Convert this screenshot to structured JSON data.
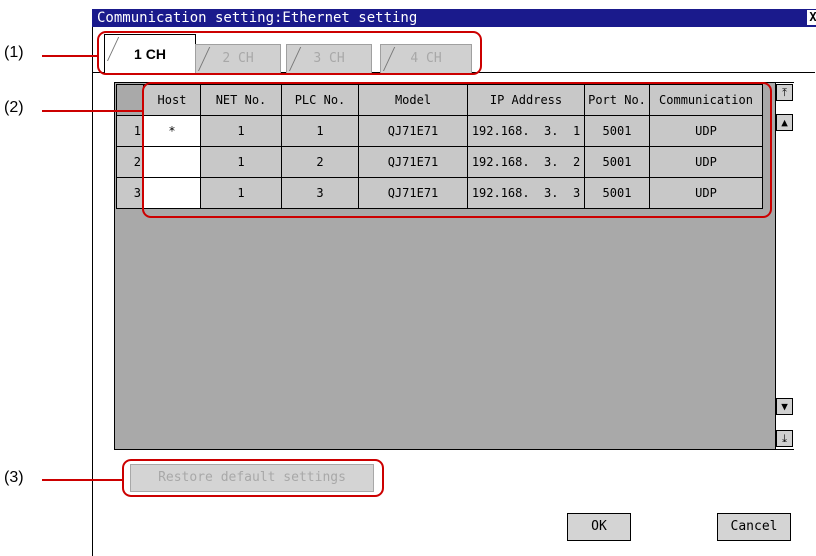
{
  "window": {
    "title": "Communication setting:Ethernet setting",
    "close_label": "X"
  },
  "tabs": [
    {
      "label": "1 CH",
      "active": true
    },
    {
      "label": "2 CH",
      "active": false
    },
    {
      "label": "3 CH",
      "active": false
    },
    {
      "label": "4 CH",
      "active": false
    }
  ],
  "table": {
    "columns": [
      "Host",
      "NET No.",
      "PLC No.",
      "Model",
      "IP Address",
      "Port No.",
      "Communication"
    ],
    "rows": [
      {
        "num": "1",
        "host": "*",
        "net": "1",
        "plc": "1",
        "model": "QJ71E71",
        "ip": "192.168.  3.  1",
        "port": "5001",
        "comm": "UDP"
      },
      {
        "num": "2",
        "host": "",
        "net": "1",
        "plc": "2",
        "model": "QJ71E71",
        "ip": "192.168.  3.  2",
        "port": "5001",
        "comm": "UDP"
      },
      {
        "num": "3",
        "host": "",
        "net": "1",
        "plc": "3",
        "model": "QJ71E71",
        "ip": "192.168.  3.  3",
        "port": "5001",
        "comm": "UDP"
      }
    ]
  },
  "buttons": {
    "restore": "Restore default settings",
    "ok": "OK",
    "cancel": "Cancel"
  },
  "callouts": {
    "c1": "(1)",
    "c2": "(2)",
    "c3": "(3)"
  },
  "icons": {
    "scroll_top": "double-up-arrow-icon",
    "scroll_up": "up-arrow-icon",
    "scroll_down": "down-arrow-icon",
    "scroll_bottom": "double-down-arrow-icon"
  },
  "colors": {
    "title_bar": "#1a1a8c",
    "callout_red": "#cc0000",
    "grid_bg": "#a9a9a9"
  }
}
